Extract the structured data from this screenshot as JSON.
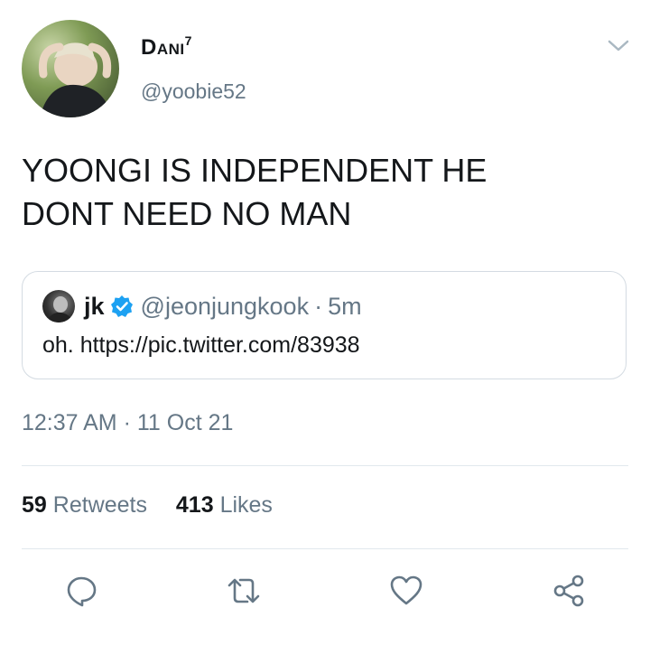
{
  "author": {
    "display_name": "Dani",
    "display_name_suffix": "7",
    "handle": "@yoobie52"
  },
  "tweet": {
    "text_line1": "YOONGI IS INDEPENDENT HE",
    "text_line2": "DONT NEED NO MAN"
  },
  "quoted_tweet": {
    "name": "jk",
    "verified": true,
    "handle": "@jeonjungkook",
    "separator": "·",
    "time": "5m",
    "text": "oh. https://pic.twitter.com/83938"
  },
  "timestamp": "12:37 AM · 11 Oct 21",
  "stats": {
    "retweets_count": "59",
    "retweets_label": "Retweets",
    "likes_count": "413",
    "likes_label": "Likes"
  },
  "icons": {
    "menu": "chevron-down-icon",
    "reply": "reply-icon",
    "retweet": "retweet-icon",
    "like": "heart-icon",
    "share": "share-icon"
  },
  "colors": {
    "text": "#14171a",
    "secondary": "#657786",
    "verified": "#1da1f2",
    "border": "#e1e8ed"
  }
}
